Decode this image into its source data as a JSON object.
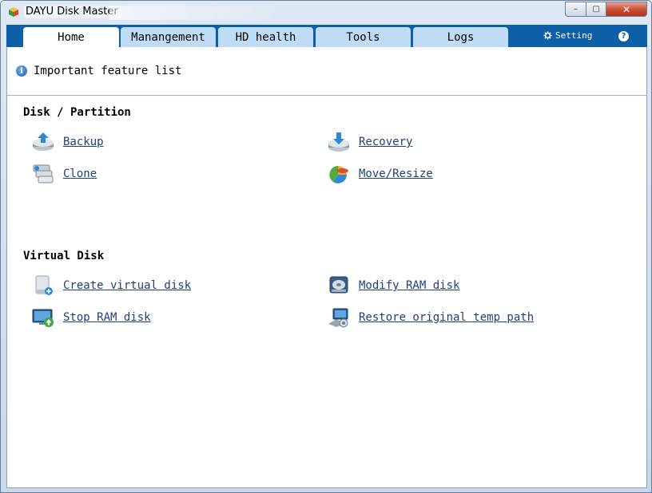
{
  "window": {
    "title": "DAYU Disk Master",
    "controls": {
      "minimize": "–",
      "maximize": "▢",
      "close": "✕"
    }
  },
  "tabs": [
    {
      "label": "Home",
      "active": true
    },
    {
      "label": "Manangement",
      "active": false
    },
    {
      "label": "HD health",
      "active": false
    },
    {
      "label": "Tools",
      "active": false
    },
    {
      "label": "Logs",
      "active": false
    }
  ],
  "toolbar": {
    "setting_label": "Setting",
    "help_label": "?"
  },
  "info": {
    "text": "Important feature list",
    "icon_glyph": "i"
  },
  "sections": [
    {
      "title": "Disk / Partition",
      "items": [
        {
          "label": "Backup",
          "icon": "backup-disk-icon"
        },
        {
          "label": "Recovery",
          "icon": "recovery-disk-icon"
        },
        {
          "label": "Clone",
          "icon": "clone-disk-icon"
        },
        {
          "label": "Move/Resize",
          "icon": "pie-partition-icon"
        }
      ]
    },
    {
      "title": "Virtual Disk",
      "items": [
        {
          "label": "Create virtual disk",
          "icon": "virtual-disk-icon"
        },
        {
          "label": "Modify RAM disk",
          "icon": "ram-disk-icon"
        },
        {
          "label": "Stop RAM disk",
          "icon": "monitor-stop-icon"
        },
        {
          "label": "Restore original temp path",
          "icon": "restore-path-icon"
        }
      ]
    }
  ],
  "colors": {
    "tabbar": "#0d5fa8",
    "tab_inactive": "#bfdcf5",
    "link": "#1f3f7a"
  }
}
